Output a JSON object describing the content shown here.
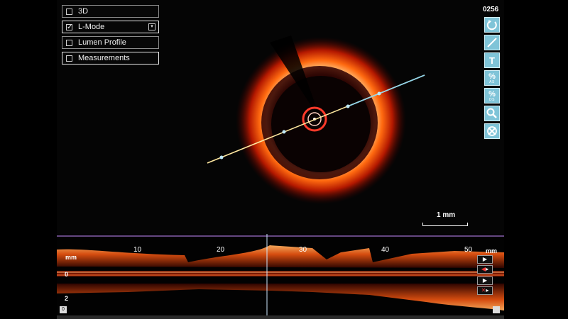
{
  "panel": {
    "items": [
      {
        "label": "3D",
        "checked": false
      },
      {
        "label": "L-Mode",
        "checked": true
      },
      {
        "label": "Lumen Profile",
        "checked": false
      },
      {
        "label": "Measurements",
        "checked": false
      }
    ]
  },
  "frame_number": "0256",
  "toolbar": {
    "tools": [
      {
        "icon": "rotate-icon"
      },
      {
        "icon": "line-measure-icon"
      },
      {
        "icon": "text-tool-icon",
        "glyph": "T"
      },
      {
        "icon": "percent-area-stenosis-icon",
        "glyph": "%",
        "sub": "AS"
      },
      {
        "icon": "percent-diameter-stenosis-icon",
        "glyph": "%",
        "sub": "DS"
      },
      {
        "icon": "zoom-icon"
      },
      {
        "icon": "clear-measurements-icon"
      }
    ]
  },
  "scale": {
    "label": "1 mm"
  },
  "lmode": {
    "unit": "mm",
    "unit_right": "mm",
    "ticks": [
      "10",
      "20",
      "30",
      "40",
      "50"
    ],
    "depth_labels": [
      "0",
      "2"
    ],
    "start_label": "0"
  },
  "colors": {
    "accent": "#7fc4d8",
    "tissue": "#ff7a2a",
    "scanline": "#ffe8a0"
  }
}
